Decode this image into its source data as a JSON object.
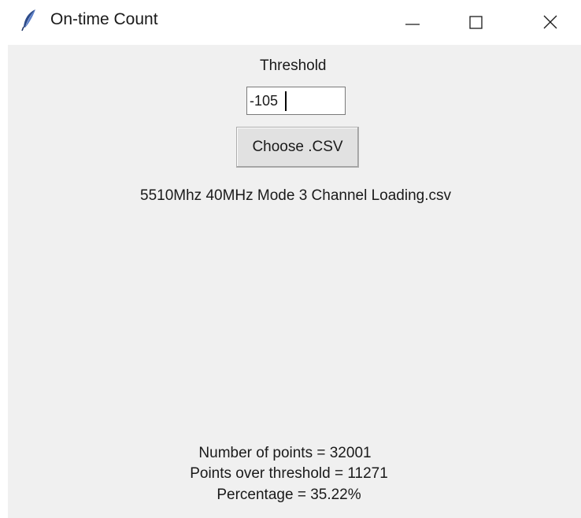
{
  "window": {
    "title": "On-time Count",
    "icon": "feather-icon",
    "controls": [
      "minimize-icon",
      "maximize-icon",
      "close-icon"
    ]
  },
  "threshold": {
    "label": "Threshold",
    "value": "-105"
  },
  "choose_button": {
    "label": "Choose .CSV"
  },
  "file": {
    "name": "5510Mhz 40MHz Mode 3 Channel Loading.csv"
  },
  "results": {
    "num_points": "Number of points = 32001",
    "points_over": "Points over threshold = 11271",
    "percentage": "Percentage = 35.22%"
  }
}
